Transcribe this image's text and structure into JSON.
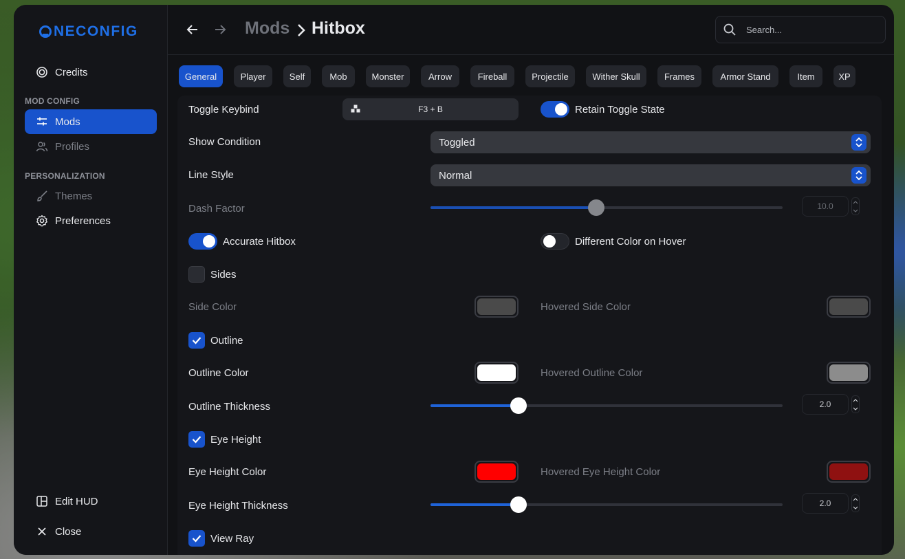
{
  "app": {
    "logo_text": "NECONFIG",
    "search_placeholder": "Search..."
  },
  "sidebar": {
    "top_item": "Credits",
    "section_mod_config": "MOD CONFIG",
    "mods": "Mods",
    "profiles": "Profiles",
    "section_personalization": "PERSONALIZATION",
    "themes": "Themes",
    "preferences": "Preferences",
    "edit_hud": "Edit HUD",
    "close": "Close"
  },
  "breadcrumb": {
    "parent": "Mods",
    "current": "Hitbox"
  },
  "tabs": [
    {
      "label": "General",
      "active": true
    },
    {
      "label": "Player"
    },
    {
      "label": "Self"
    },
    {
      "label": "Mob"
    },
    {
      "label": "Monster"
    },
    {
      "label": "Arrow"
    },
    {
      "label": "Fireball"
    },
    {
      "label": "Projectile"
    },
    {
      "label": "Wither Skull"
    },
    {
      "label": "Frames"
    },
    {
      "label": "Armor Stand"
    },
    {
      "label": "Item"
    },
    {
      "label": "XP"
    }
  ],
  "settings": {
    "toggle_keybind": {
      "label": "Toggle Keybind",
      "value": "F3 + B"
    },
    "retain_toggle_state": {
      "label": "Retain Toggle State",
      "on": true
    },
    "show_condition": {
      "label": "Show Condition",
      "value": "Toggled"
    },
    "line_style": {
      "label": "Line Style",
      "value": "Normal"
    },
    "dash_factor": {
      "label": "Dash Factor",
      "value": "10.0",
      "fraction": 0.47,
      "disabled": true
    },
    "accurate_hitbox": {
      "label": "Accurate Hitbox",
      "on": true
    },
    "different_color_on_hover": {
      "label": "Different Color on Hover",
      "on": false
    },
    "sides": {
      "label": "Sides",
      "checked": false
    },
    "side_color": {
      "label": "Side Color",
      "color": "#4a4a4a"
    },
    "hovered_side_color": {
      "label": "Hovered Side Color",
      "color": "#4a4a4a"
    },
    "outline": {
      "label": "Outline",
      "checked": true
    },
    "outline_color": {
      "label": "Outline Color",
      "color": "#ffffff"
    },
    "hovered_outline_color": {
      "label": "Hovered Outline Color",
      "color": "#8c8c8c"
    },
    "outline_thickness": {
      "label": "Outline Thickness",
      "value": "2.0",
      "fraction": 0.25
    },
    "eye_height": {
      "label": "Eye Height",
      "checked": true
    },
    "eye_height_color": {
      "label": "Eye Height Color",
      "color": "#ff0000"
    },
    "hovered_eye_height_color": {
      "label": "Hovered Eye Height Color",
      "color": "#8f1111"
    },
    "eye_height_thickness": {
      "label": "Eye Height Thickness",
      "value": "2.0",
      "fraction": 0.25
    },
    "view_ray": {
      "label": "View Ray",
      "checked": true
    }
  },
  "colors": {
    "accent": "#1853cc",
    "background": "#111215",
    "panel": "#15161a"
  }
}
